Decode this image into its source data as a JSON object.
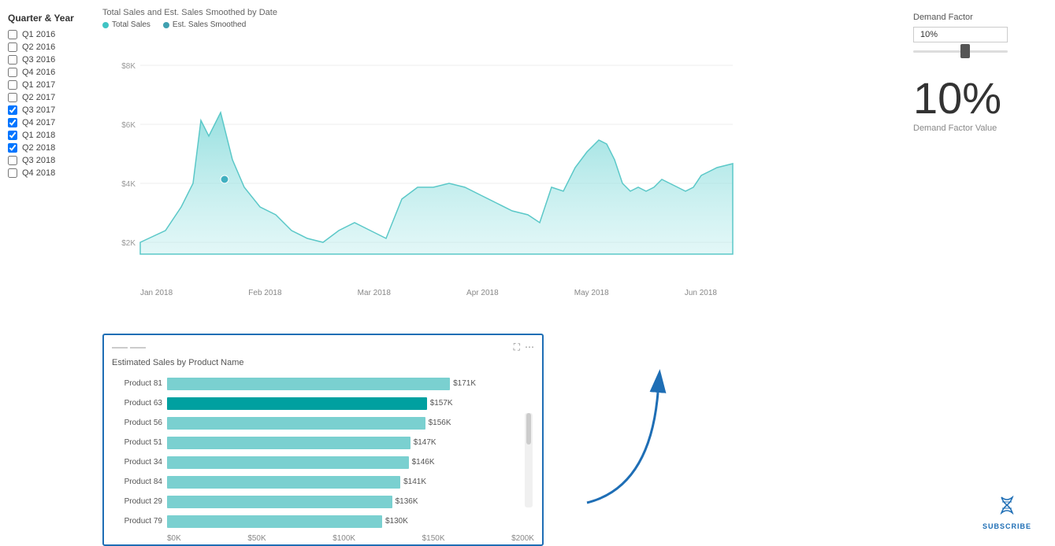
{
  "sidebar": {
    "title": "Quarter & Year",
    "filters": [
      {
        "label": "Q1 2016",
        "checked": false
      },
      {
        "label": "Q2 2016",
        "checked": false
      },
      {
        "label": "Q3 2016",
        "checked": false
      },
      {
        "label": "Q4 2016",
        "checked": false
      },
      {
        "label": "Q1 2017",
        "checked": false
      },
      {
        "label": "Q2 2017",
        "checked": false
      },
      {
        "label": "Q3 2017",
        "checked": true
      },
      {
        "label": "Q4 2017",
        "checked": true
      },
      {
        "label": "Q1 2018",
        "checked": true
      },
      {
        "label": "Q2 2018",
        "checked": true
      },
      {
        "label": "Q3 2018",
        "checked": false
      },
      {
        "label": "Q4 2018",
        "checked": false
      }
    ]
  },
  "area_chart": {
    "title": "Total Sales and Est. Sales Smoothed by Date",
    "legend": [
      {
        "label": "Total Sales",
        "color": "#40c4c4"
      },
      {
        "label": "Est. Sales Smoothed",
        "color": "#40a0b0"
      }
    ],
    "y_labels": [
      "$8K",
      "$6K",
      "$4K",
      "$2K"
    ],
    "x_labels": [
      "Jan 2018",
      "Feb 2018",
      "Mar 2018",
      "Apr 2018",
      "May 2018",
      "Jun 2018"
    ]
  },
  "bar_chart": {
    "title": "Estimated Sales by Product Name",
    "bars": [
      {
        "product": "Product 81",
        "value": 171000,
        "display": "$171K",
        "color": "#7ad0d0",
        "highlighted": false
      },
      {
        "product": "Product 63",
        "value": 157000,
        "display": "$157K",
        "color": "#00b0b0",
        "highlighted": true
      },
      {
        "product": "Product 56",
        "value": 156000,
        "display": "$156K",
        "color": "#7ad0d0",
        "highlighted": false
      },
      {
        "product": "Product 51",
        "value": 147000,
        "display": "$147K",
        "color": "#7ad0d0",
        "highlighted": false
      },
      {
        "product": "Product 34",
        "value": 146000,
        "display": "$146K",
        "color": "#7ad0d0",
        "highlighted": false
      },
      {
        "product": "Product 84",
        "value": 141000,
        "display": "$141K",
        "color": "#7ad0d0",
        "highlighted": false
      },
      {
        "product": "Product 29",
        "value": 136000,
        "display": "$136K",
        "color": "#7ad0d0",
        "highlighted": false
      },
      {
        "product": "Product 79",
        "value": 130000,
        "display": "$130K",
        "color": "#7ad0d0",
        "highlighted": false
      }
    ],
    "x_axis": [
      "$0K",
      "$50K",
      "$100K",
      "$150K",
      "$200K"
    ],
    "max_value": 200000
  },
  "demand_factor": {
    "label": "Demand Factor",
    "slider_value": "10%",
    "big_value": "10%",
    "description": "Demand Factor Value"
  },
  "subscribe": {
    "text": "SUBSCRIBE"
  }
}
